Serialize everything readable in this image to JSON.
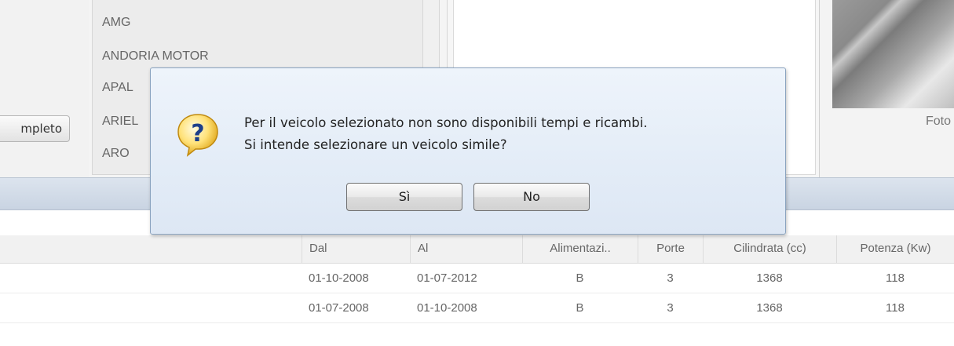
{
  "left_panel": {
    "complete_button_label": "mpleto"
  },
  "brand_list": {
    "items": [
      "AMG",
      "ANDORIA MOTOR",
      "APAL",
      "ARIEL",
      "ARO"
    ]
  },
  "photo_panel": {
    "label": "Foto"
  },
  "table": {
    "columns": [
      "Dal",
      "Al",
      "Alimentazi..",
      "Porte",
      "Cilindrata (cc)",
      "Potenza (Kw)"
    ],
    "rows": [
      [
        "01-10-2008",
        "01-07-2012",
        "B",
        "3",
        "1368",
        "118"
      ],
      [
        "01-07-2008",
        "01-10-2008",
        "B",
        "3",
        "1368",
        "118"
      ]
    ]
  },
  "dialog": {
    "icon": "question-icon",
    "message_line1": "Per il veicolo selezionato non sono disponibili tempi e ricambi.",
    "message_line2": "Si intende selezionare un veicolo simile?",
    "yes_label": "Sì",
    "no_label": "No"
  },
  "colors": {
    "dialog_bg": "#e3ecf7",
    "band": "#cfd9e6"
  }
}
